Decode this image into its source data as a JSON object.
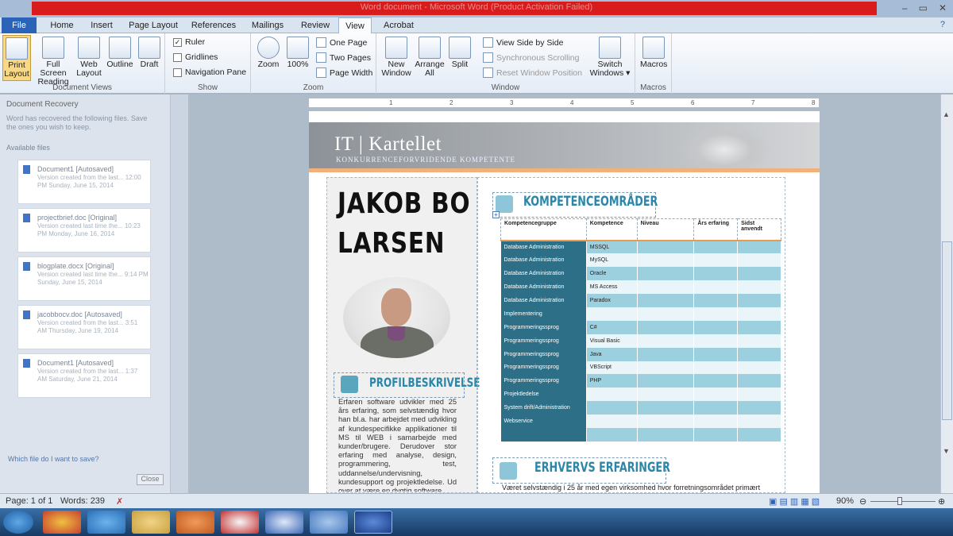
{
  "window": {
    "title": "Word document - Microsoft Word (Product Activation Failed)",
    "controls": [
      "–",
      "▭",
      "✕"
    ]
  },
  "ribbon": {
    "tabs": [
      "File",
      "Home",
      "Insert",
      "Page Layout",
      "References",
      "Mailings",
      "Review",
      "View",
      "Acrobat"
    ],
    "active_tab": "View",
    "groups": {
      "document_views": {
        "label": "Document Views",
        "buttons": [
          "Print Layout",
          "Full Screen Reading",
          "Web Layout",
          "Outline",
          "Draft"
        ]
      },
      "show": {
        "label": "Show",
        "items": [
          {
            "label": "Ruler",
            "checked": true
          },
          {
            "label": "Gridlines",
            "checked": false
          },
          {
            "label": "Navigation Pane",
            "checked": false
          }
        ]
      },
      "zoom": {
        "label": "Zoom",
        "buttons": [
          "Zoom",
          "100%"
        ],
        "small": [
          "One Page",
          "Two Pages",
          "Page Width"
        ]
      },
      "window": {
        "label": "Window",
        "buttons": [
          "New Window",
          "Arrange All",
          "Split"
        ],
        "small": [
          "View Side by Side",
          "Synchronous Scrolling",
          "Reset Window Position"
        ],
        "switch": "Switch Windows"
      },
      "macros": {
        "label": "Macros",
        "button": "Macros"
      }
    }
  },
  "recovery": {
    "title": "Document Recovery",
    "text": "Word has recovered the following files. Save the ones you wish to keep.",
    "available": "Available files",
    "files": [
      {
        "name": "Document1 [Autosaved]",
        "info": "Version created from the last... 12:00 PM Sunday, June 15, 2014"
      },
      {
        "name": "projectbrief.doc [Original]",
        "info": "Version created last time the... 10:23 PM Monday, June 16, 2014"
      },
      {
        "name": "blogplate.docx [Original]",
        "info": "Version created last time the... 9:14 PM Sunday, June 15, 2014"
      },
      {
        "name": "jacobbocv.doc [Autosaved]",
        "info": "Version created from the last... 3:51 AM Thursday, June 19, 2014"
      },
      {
        "name": "Document1 [Autosaved]",
        "info": "Version created from the last... 1:37 AM Saturday, June 21, 2014"
      }
    ],
    "link": "Which file do I want to save?",
    "close": "Close"
  },
  "document": {
    "brand": "IT | Kartellet",
    "tagline": "KONKURRENCEFORVRIDENDE KOMPETENTE",
    "name_line1": "JAKOB BO",
    "name_line2": "LARSEN",
    "profile_heading": "PROFILBESKRIVELSE",
    "profile_text": "Erfaren software udvikler med 25 års erfaring, som selvstændig hvor han bl.a. har arbejdet med udvikling af kundespecifikke applikationer til MS til WEB i samarbejde med kunder/brugere. Derudover stor erfaring med analyse, design, programmering, test, uddannelse/undervisning, kundesupport og projektledelse. Ud over at være en dygtig software",
    "skills_heading": "KOMPETENCEOMRÅDER",
    "table_headers": [
      "Kompetencegruppe",
      "Kompetence",
      "Niveau",
      "Års erfaring",
      "Sidst anvendt"
    ],
    "table_rows": [
      [
        "Database Administration",
        "MSSQL"
      ],
      [
        "Database Administration",
        "MySQL"
      ],
      [
        "Database Administration",
        "Oracle"
      ],
      [
        "Database Administration",
        "MS Access"
      ],
      [
        "Database Administration",
        "Paradox"
      ],
      [
        "Implementering",
        ""
      ],
      [
        "Programmeringssprog",
        "C#"
      ],
      [
        "Programmeringssprog",
        "Visual Basic"
      ],
      [
        "Programmeringssprog",
        "Java"
      ],
      [
        "Programmeringssprog",
        "VBScript"
      ],
      [
        "Programmeringssprog",
        "PHP"
      ],
      [
        "Projektledelse",
        ""
      ],
      [
        "System drift/Administration",
        ""
      ],
      [
        "Webservice",
        ""
      ],
      [
        "",
        ""
      ]
    ],
    "experience_heading": "ERHVERVS ERFARINGER",
    "experience_line": "Været selvstændig i 25 år med egen virksomhed hvor forretningsområdet primært"
  },
  "ruler_numbers": [
    "1",
    "2",
    "3",
    "4",
    "5",
    "6",
    "7",
    "8"
  ],
  "status": {
    "page": "Page: 1 of 1",
    "words": "Words: 239",
    "zoom": "90%"
  },
  "colors": {
    "accent": "#2b86a8",
    "table_dark": "#2d6f86",
    "table_light": "#9dd0de",
    "orange": "#f2b07a"
  }
}
